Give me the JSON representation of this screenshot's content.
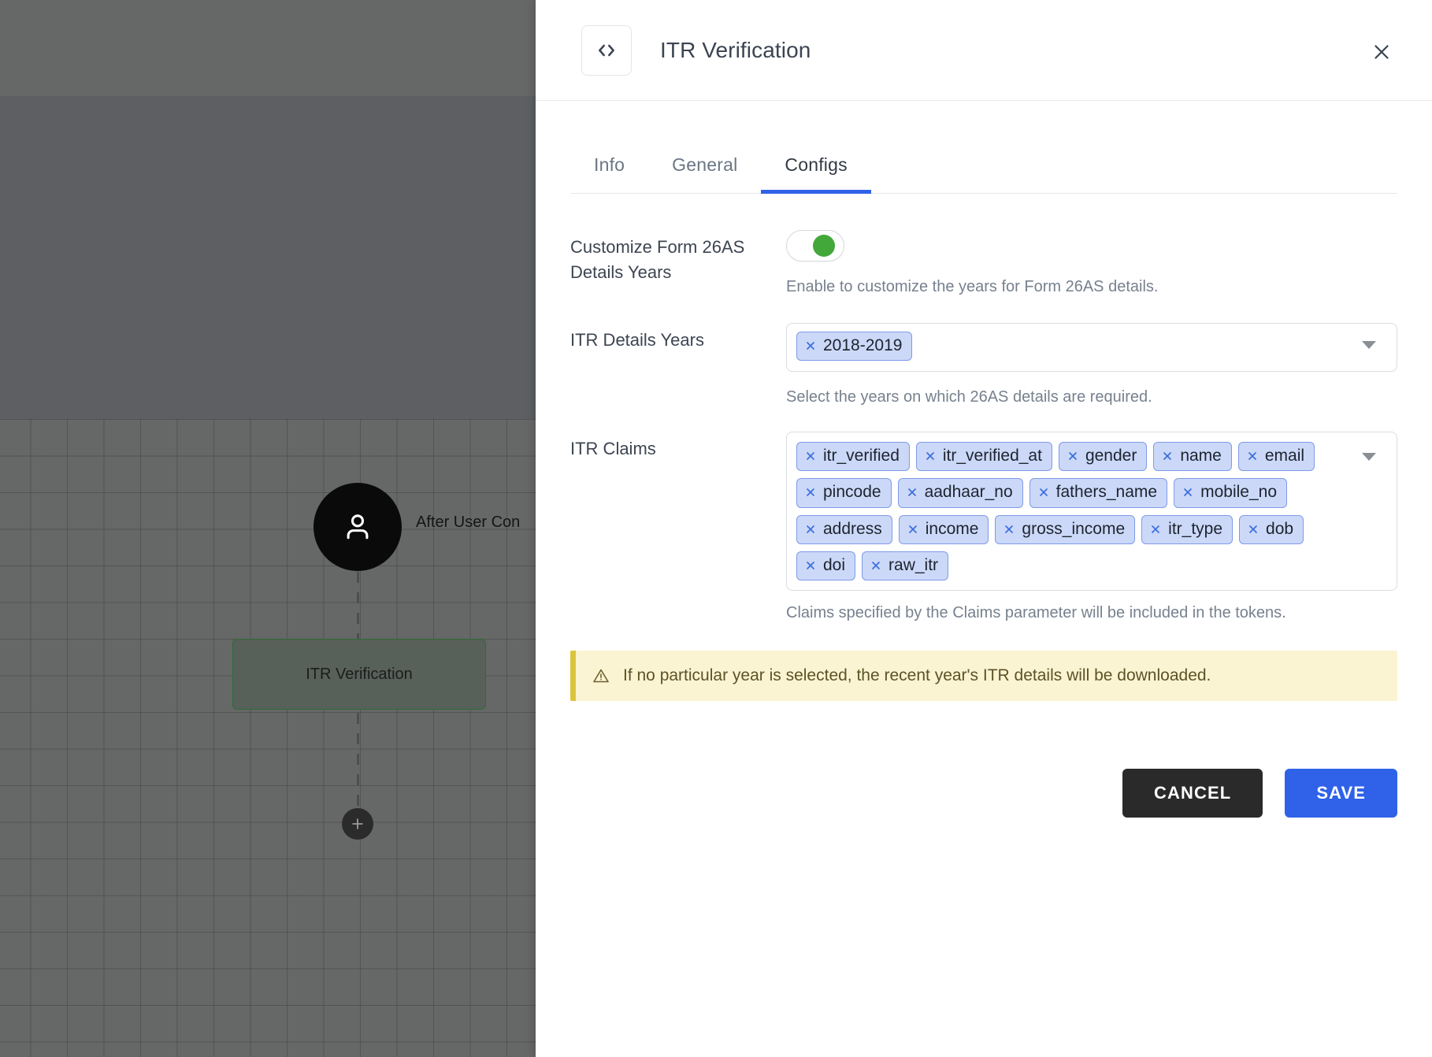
{
  "canvas": {
    "user_node_label": "After User Con",
    "task_node_label": "ITR Verification",
    "user_icon": "user-icon",
    "add_icon": "plus-icon"
  },
  "drawer": {
    "icon": "code-brackets-icon",
    "title": "ITR Verification",
    "close_icon": "close-icon",
    "tabs": [
      {
        "label": "Info",
        "active": false
      },
      {
        "label": "General",
        "active": false
      },
      {
        "label": "Configs",
        "active": true
      }
    ],
    "configs": {
      "customize_form26as": {
        "label": "Customize Form 26AS Details Years",
        "toggle_on": true,
        "helper": "Enable to customize the years for Form 26AS details."
      },
      "itr_details_years": {
        "label": "ITR Details Years",
        "chips": [
          "2018-2019"
        ],
        "helper": "Select the years on which 26AS details are required.",
        "caret_icon": "chevron-down-icon"
      },
      "itr_claims": {
        "label": "ITR Claims",
        "chips": [
          "itr_verified",
          "itr_verified_at",
          "gender",
          "name",
          "email",
          "pincode",
          "aadhaar_no",
          "fathers_name",
          "mobile_no",
          "address",
          "income",
          "gross_income",
          "itr_type",
          "dob",
          "doi",
          "raw_itr"
        ],
        "helper": "Claims specified by the Claims parameter will be included in the tokens.",
        "caret_icon": "chevron-down-icon"
      },
      "warning": {
        "icon": "warning-triangle-icon",
        "text": "If no particular year is selected, the recent year's ITR details will be downloaded."
      },
      "cancel_label": "CANCEL",
      "save_label": "SAVE"
    }
  },
  "colors": {
    "accent_blue": "#2f62e8",
    "toggle_green": "#43a83a",
    "chip_bg": "#ccd8f7",
    "chip_border": "#7d9bea",
    "warning_bg": "#fbf4d2",
    "warning_border": "#ddc43f",
    "cancel_bg": "#2a2a2a",
    "node_border_green": "#2f6b35"
  }
}
